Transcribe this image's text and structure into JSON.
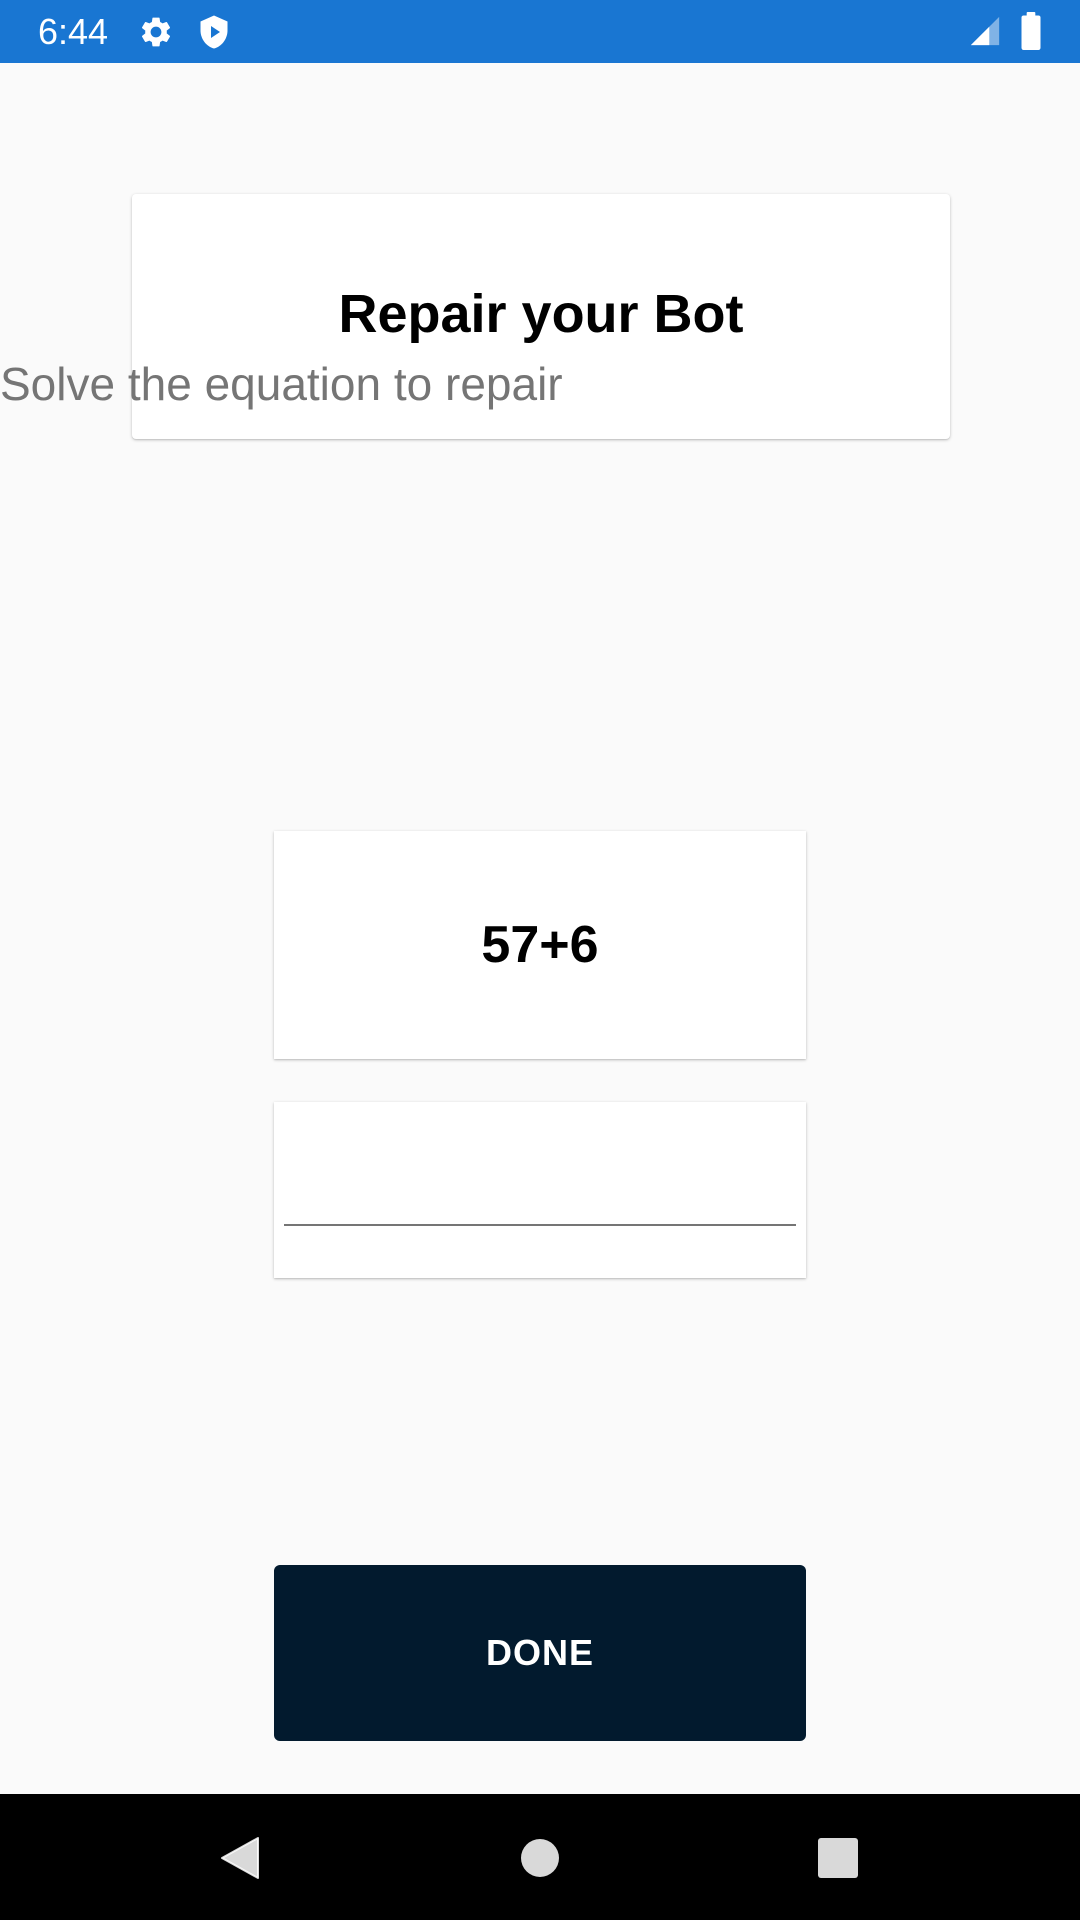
{
  "status_bar": {
    "time": "6:44",
    "icons": [
      "gear-icon",
      "shield-play-icon",
      "signal-icon",
      "battery-icon"
    ],
    "color": "#1976d2"
  },
  "header": {
    "title": "Repair your Bot",
    "subtitle": "Solve the equation to repair"
  },
  "equation": {
    "text": "57+6"
  },
  "answer_input": {
    "value": "",
    "placeholder": ""
  },
  "done_button": {
    "label": "DONE",
    "color": "#021a2e"
  },
  "nav_bar": {
    "icons": [
      "back-icon",
      "home-icon",
      "recents-icon"
    ]
  }
}
